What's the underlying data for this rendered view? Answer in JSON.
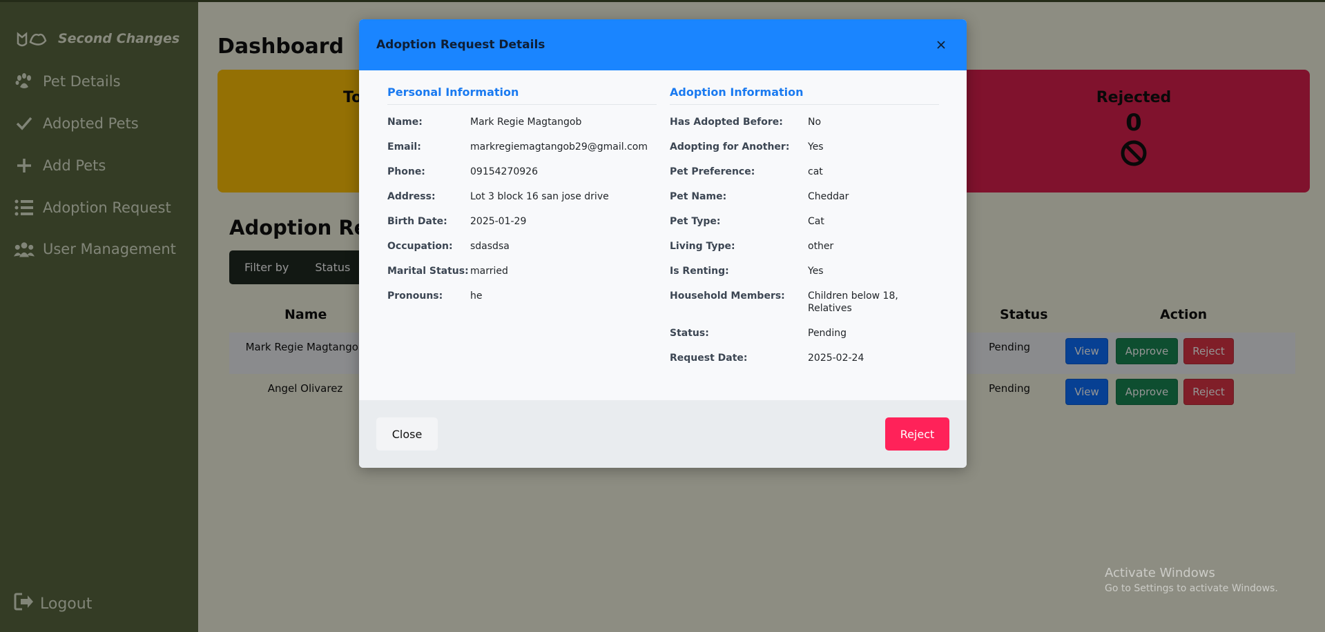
{
  "sidebar": {
    "brand": "Second Changes",
    "items": [
      {
        "label": "Pet Details"
      },
      {
        "label": "Adopted Pets"
      },
      {
        "label": "Add Pets"
      },
      {
        "label": "Adoption Request"
      },
      {
        "label": "User Management"
      }
    ],
    "logout": "Logout"
  },
  "main": {
    "title": "Dashboard",
    "cards": {
      "total_label_partial": "To",
      "rejected_label": "Rejected",
      "rejected_value": "0"
    },
    "section_title": "Adoption Requests",
    "filter": {
      "label": "Filter by",
      "status": "Status"
    },
    "table": {
      "headers": {
        "name": "Name",
        "status": "Status",
        "action": "Action"
      },
      "rows": [
        {
          "name": "Mark Regie Magtangob",
          "status": "Pending"
        },
        {
          "name": "Angel Olivarez",
          "status": "Pending"
        }
      ],
      "buttons": {
        "view": "View",
        "approve": "Approve",
        "reject": "Reject"
      }
    }
  },
  "modal": {
    "title": "Adoption Request Details",
    "personal": {
      "heading": "Personal Information",
      "fields": [
        {
          "label": "Name:",
          "value": "Mark Regie Magtangob"
        },
        {
          "label": "Email:",
          "value": "markregiemagtangob29@gmail.com"
        },
        {
          "label": "Phone:",
          "value": "09154270926"
        },
        {
          "label": "Address:",
          "value": "Lot 3 block 16 san jose drive"
        },
        {
          "label": "Birth Date:",
          "value": "2025-01-29"
        },
        {
          "label": "Occupation:",
          "value": "sdasdsa"
        },
        {
          "label": "Marital Status:",
          "value": "married"
        },
        {
          "label": "Pronouns:",
          "value": "he"
        }
      ]
    },
    "adoption": {
      "heading": "Adoption Information",
      "fields": [
        {
          "label": "Has Adopted Before:",
          "value": "No"
        },
        {
          "label": "Adopting for Another:",
          "value": "Yes"
        },
        {
          "label": "Pet Preference:",
          "value": "cat"
        },
        {
          "label": "Pet Name:",
          "value": "Cheddar"
        },
        {
          "label": "Pet Type:",
          "value": "Cat"
        },
        {
          "label": "Living Type:",
          "value": "other"
        },
        {
          "label": "Is Renting:",
          "value": "Yes"
        },
        {
          "label": "Household Members:",
          "value": "Children below 18, Relatives"
        },
        {
          "label": "Status:",
          "value": "Pending"
        },
        {
          "label": "Request Date:",
          "value": "2025-02-24"
        }
      ]
    },
    "close_label": "Close",
    "reject_label": "Reject"
  },
  "watermark": {
    "line1": "Activate Windows",
    "line2": "Go to Settings to activate Windows."
  },
  "colors": {
    "sidebar": "#5a6840",
    "modal_header": "#1a85ff",
    "reject": "#ff2259",
    "accent_text": "#1a7af0"
  }
}
